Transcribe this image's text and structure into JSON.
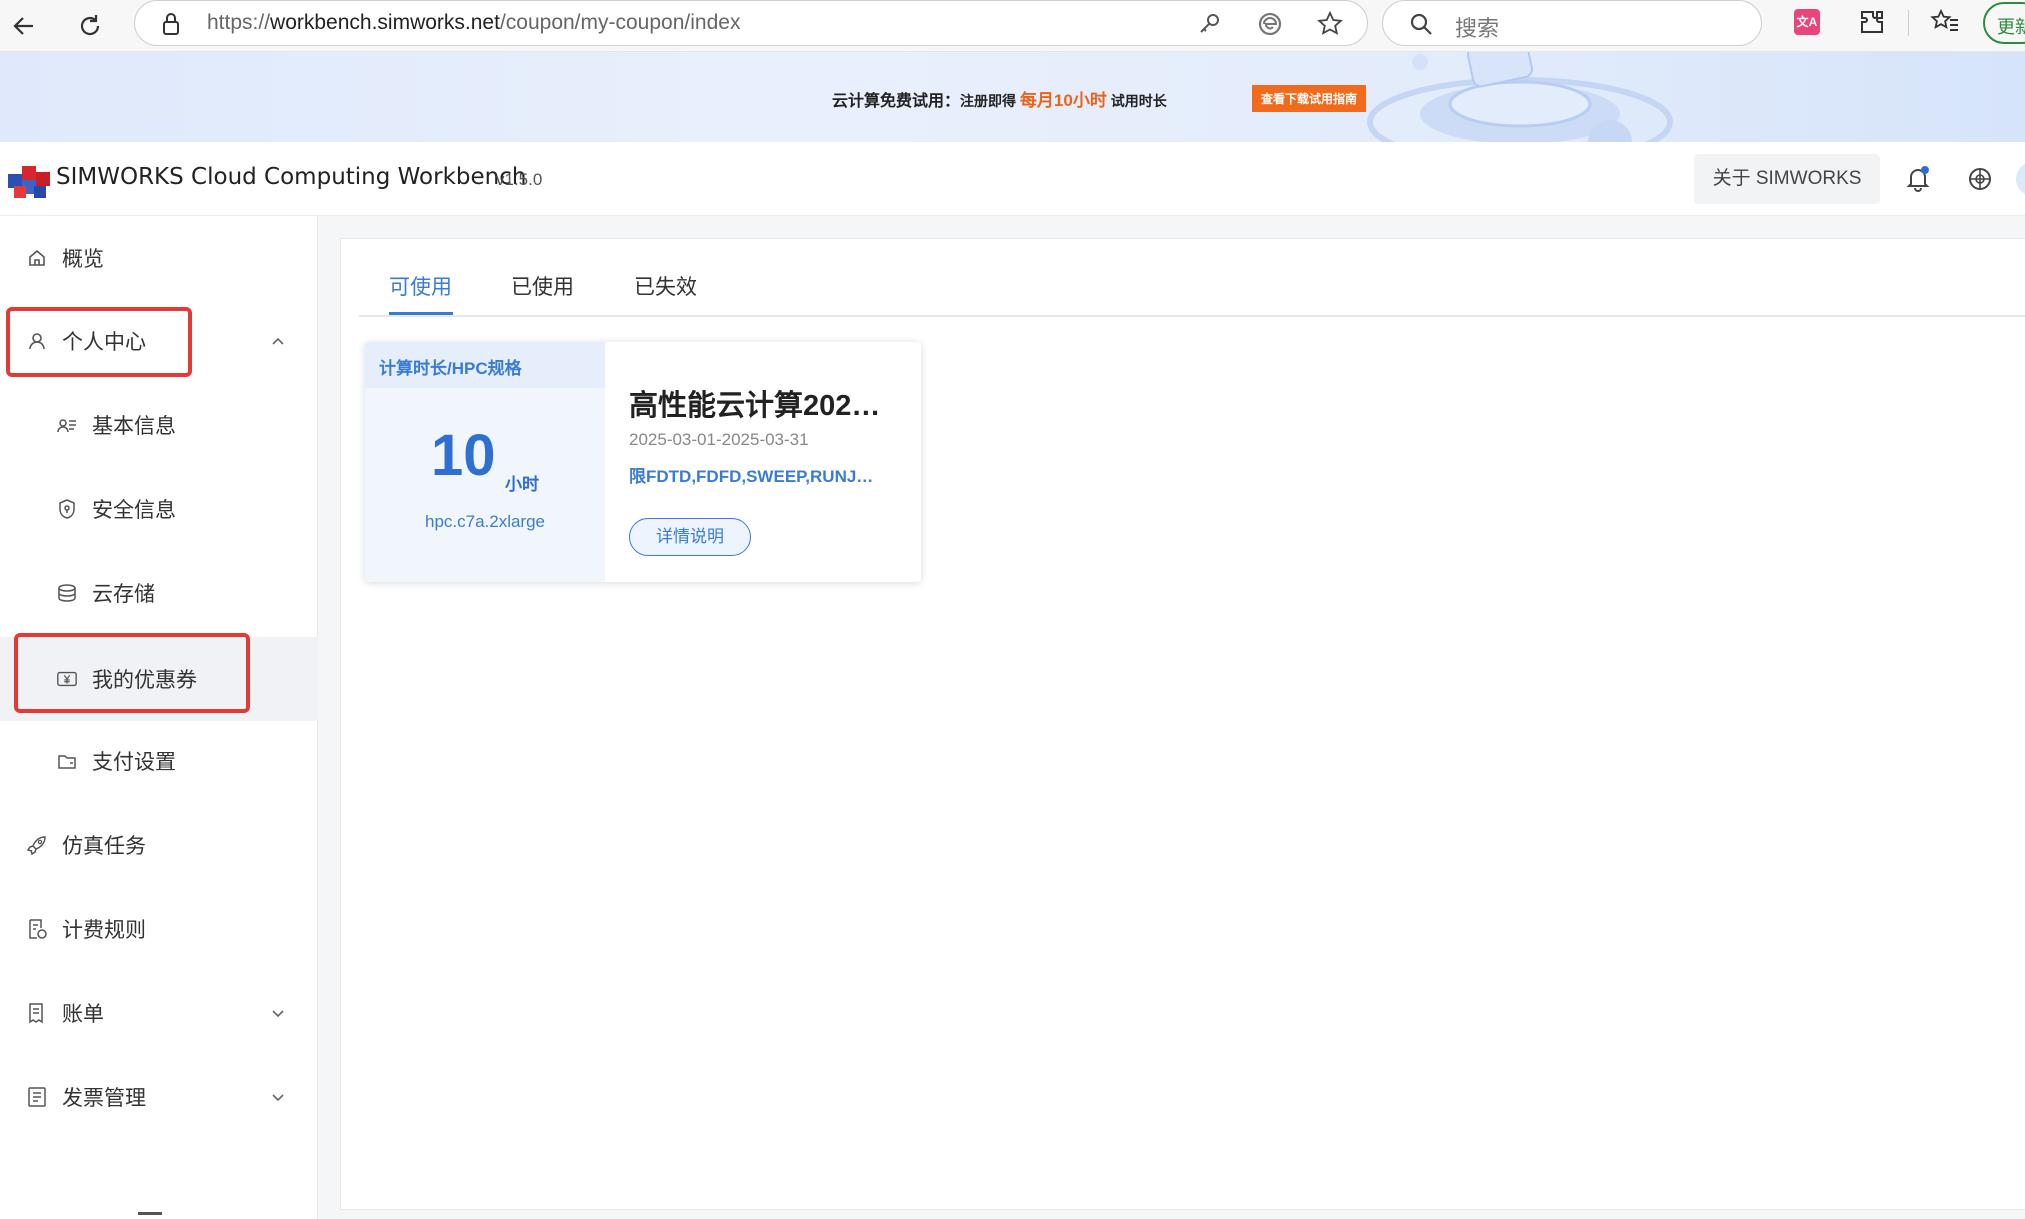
{
  "browser": {
    "url_prefix": "https://",
    "url_domain": "workbench.simworks.net",
    "url_path": "/coupon/my-coupon/index",
    "search_placeholder": "搜索",
    "update_label": "更新"
  },
  "banner": {
    "text_lead": "云计算免费试用：",
    "text_mid": "注册即得 ",
    "text_highlight": "每月10小时",
    "text_tail": " 试用时长",
    "button_label": "查看下载试用指南"
  },
  "header": {
    "app_title": "SIMWORKS Cloud Computing Workbench",
    "version": "v1.5.0",
    "about_label": "关于 SIMWORKS"
  },
  "sidebar": {
    "items": [
      {
        "label": "概览",
        "icon": "home-icon"
      },
      {
        "label": "个人中心",
        "icon": "user-icon"
      },
      {
        "label": "基本信息",
        "icon": "id-card-icon"
      },
      {
        "label": "安全信息",
        "icon": "shield-icon"
      },
      {
        "label": "云存储",
        "icon": "database-icon"
      },
      {
        "label": "我的优惠券",
        "icon": "coupon-icon"
      },
      {
        "label": "支付设置",
        "icon": "wallet-icon"
      },
      {
        "label": "仿真任务",
        "icon": "rocket-icon"
      },
      {
        "label": "计费规则",
        "icon": "billing-rule-icon"
      },
      {
        "label": "账单",
        "icon": "bill-icon"
      },
      {
        "label": "发票管理",
        "icon": "invoice-icon"
      }
    ]
  },
  "tabs": [
    {
      "label": "可使用"
    },
    {
      "label": "已使用"
    },
    {
      "label": "已失效"
    }
  ],
  "coupon": {
    "tag": "计算时长/HPC规格",
    "amount": "10",
    "unit": "小时",
    "spec": "hpc.c7a.2xlarge",
    "title": "高性能云计算202…",
    "date_range": "2025-03-01-2025-03-31",
    "limit": "限FDTD,FDFD,SWEEP,RUNJ…",
    "detail_label": "详情说明"
  },
  "colors": {
    "accent": "#3a7bd5",
    "highlight_box": "#e53935",
    "banner_button": "#f26a1b"
  }
}
